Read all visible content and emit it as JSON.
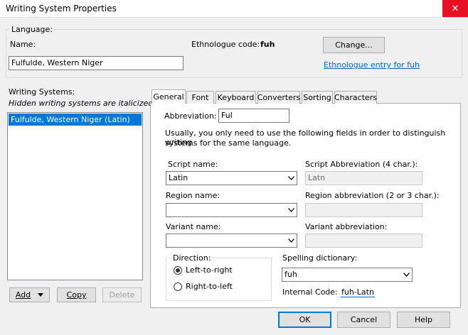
{
  "window": {
    "title": "Writing System Properties",
    "close_symbol": "✕"
  },
  "language": {
    "group_label": "Language:",
    "name_label": "Name:",
    "name_value": "Fulfulde, Western Niger",
    "ethnologue_label": "Ethnologue code:",
    "ethnologue_code": "fuh",
    "change_button": "Change...",
    "ethnologue_link": "Ethnologue entry for fuh"
  },
  "writing_systems": {
    "label": "Writing Systems:",
    "hidden_note": "Hidden writing systems are italicized",
    "items": [
      "Fulfulde, Western Niger (Latin)"
    ],
    "add_button": "Add",
    "copy_button": "Copy",
    "delete_button": "Delete"
  },
  "tabs": [
    "General",
    "Font",
    "Keyboard",
    "Converters",
    "Sorting",
    "Characters"
  ],
  "general": {
    "abbreviation_label": "Abbreviation:",
    "abbreviation_value": "Ful",
    "info_text_line1": "Usually, you only need to use the following fields in order to distinguish writing",
    "info_text_line2": "systems for the same language.",
    "script_name_label": "Script name:",
    "script_name_value": "Latin",
    "script_abbrev_label": "Script Abbreviation (4 char.):",
    "script_abbrev_value": "Latn",
    "region_name_label": "Region name:",
    "region_name_value": "",
    "region_abbrev_label": "Region abbreviation (2 or 3 char.):",
    "region_abbrev_value": "",
    "variant_name_label": "Variant name:",
    "variant_name_value": "",
    "variant_abbrev_label": "Variant abbreviation:",
    "variant_abbrev_value": "",
    "direction_label": "Direction:",
    "ltr_label": "Left-to-right",
    "rtl_label": "Right-to-left",
    "direction_selected": "Left-to-right",
    "spelling_label": "Spelling dictionary:",
    "spelling_value": "fuh",
    "internal_code_label": "Internal Code:",
    "internal_code_value": "fuh-Latn"
  },
  "footer": {
    "ok": "OK",
    "cancel": "Cancel",
    "help": "Help"
  },
  "colors": {
    "selection": "#0078d7",
    "link": "#0066cc",
    "close": "#e81123"
  }
}
